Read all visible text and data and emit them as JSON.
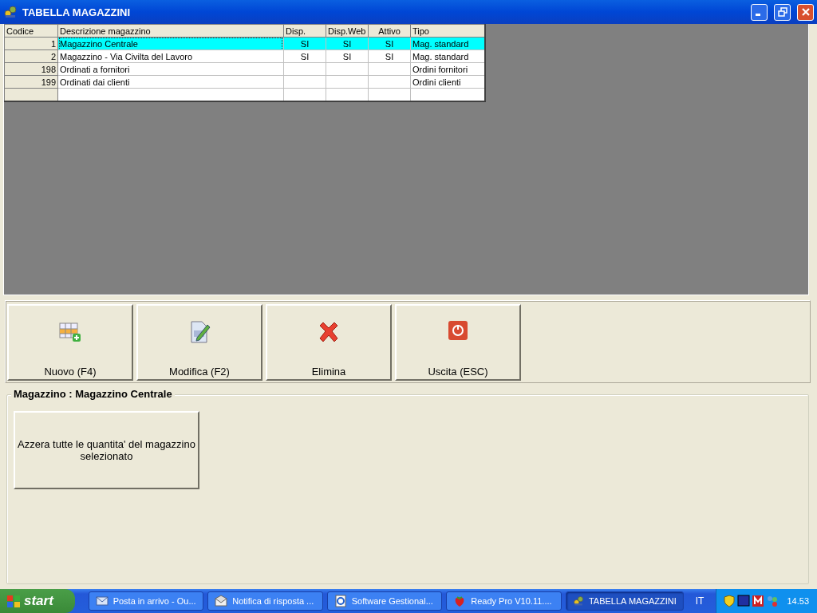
{
  "window": {
    "title": "TABELLA MAGAZZINI"
  },
  "table": {
    "columns": [
      "Codice",
      "Descrizione magazzino",
      "Disp.",
      "Disp.Web",
      "Attivo",
      "Tipo"
    ],
    "rows": [
      {
        "cells": [
          "1",
          "Magazzino Centrale",
          "SI",
          "SI",
          "SI",
          "Mag. standard"
        ],
        "selected": true
      },
      {
        "cells": [
          "2",
          "Magazzino - Via Civilta del Lavoro",
          "SI",
          "SI",
          "SI",
          "Mag. standard"
        ],
        "selected": false
      },
      {
        "cells": [
          "198",
          "Ordinati a fornitori",
          "",
          "",
          "",
          "Ordini fornitori"
        ],
        "selected": false
      },
      {
        "cells": [
          "199",
          "Ordinati dai clienti",
          "",
          "",
          "",
          "Ordini clienti"
        ],
        "selected": false
      }
    ]
  },
  "toolbar": {
    "buttons": [
      {
        "label": "Nuovo (F4)",
        "kind": "new"
      },
      {
        "label": "Modifica (F2)",
        "kind": "edit"
      },
      {
        "label": "Elimina",
        "kind": "delete"
      },
      {
        "label": "Uscita (ESC)",
        "kind": "exit"
      }
    ]
  },
  "group": {
    "title": "Magazzino : Magazzino Centrale",
    "buttons": [
      "Azzera tutte le quantita' del magazzino selezionato"
    ]
  },
  "taskbar": {
    "start": "start",
    "tasks": [
      {
        "label": "Posta in arrivo - Ou...",
        "kind": "mail",
        "selected": false
      },
      {
        "label": "Notifica di risposta ...",
        "kind": "envelope",
        "selected": false
      },
      {
        "label": "Software Gestional...",
        "kind": "browser",
        "selected": false
      },
      {
        "label": "Ready Pro V10.11....",
        "kind": "strawberry",
        "selected": false
      },
      {
        "label": "TABELLA MAGAZZINI",
        "kind": "app",
        "selected": true
      }
    ],
    "language": "IT",
    "clock": "14.53"
  }
}
